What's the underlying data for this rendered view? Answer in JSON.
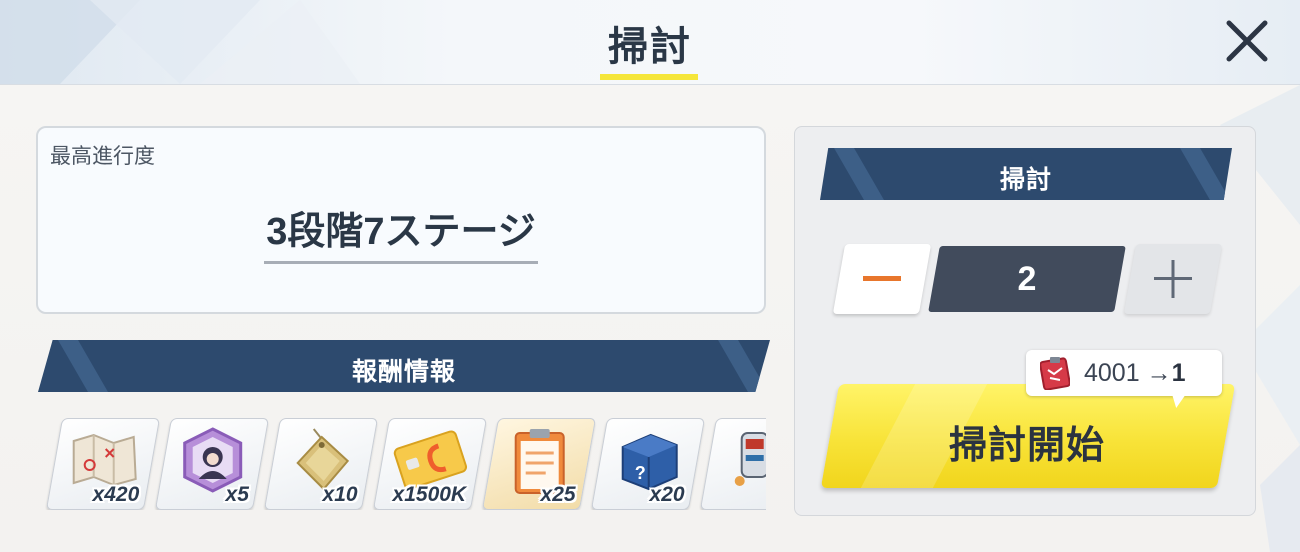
{
  "header": {
    "title": "掃討",
    "close_icon": "close-icon"
  },
  "progress": {
    "label": "最高進行度",
    "value": "3段階7ステージ"
  },
  "rewards": {
    "banner": "報酬情報",
    "items": [
      {
        "icon": "map-icon",
        "qty": "x420"
      },
      {
        "icon": "character-eleph-icon",
        "qty": "x5"
      },
      {
        "icon": "gold-tag-icon",
        "qty": "x10"
      },
      {
        "icon": "credit-card-icon",
        "qty": "x1500K"
      },
      {
        "icon": "report-clipboard-icon",
        "qty": "x25"
      },
      {
        "icon": "mystery-box-icon",
        "qty": "x20"
      },
      {
        "icon": "equipment-icon",
        "qty": ""
      }
    ]
  },
  "sweep": {
    "banner": "掃討",
    "count": "2",
    "minus_icon": "minus-icon",
    "plus_icon": "plus-icon",
    "cost_icon": "ticket-icon",
    "cost_current": "4001",
    "cost_arrow": "→",
    "cost_amount": "1",
    "start_label": "掃討開始"
  },
  "colors": {
    "accent_yellow": "#f5e63a",
    "banner_navy": "#2d4a6e",
    "count_box": "#414b5c",
    "minus_orange": "#e8762c"
  }
}
